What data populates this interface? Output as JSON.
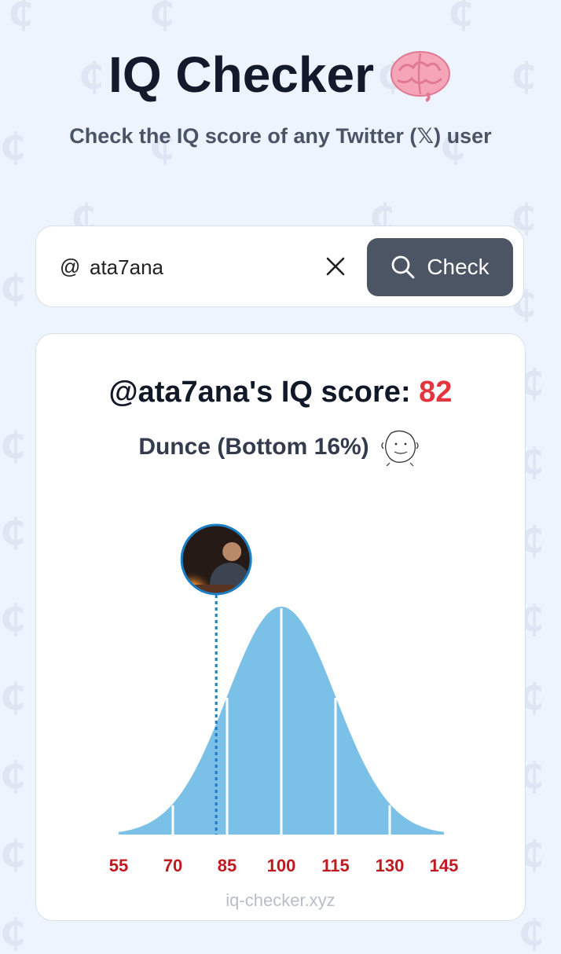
{
  "app": {
    "title": "IQ Checker",
    "title_emoji": "🧠",
    "subtitle": "Check the IQ score of any Twitter (𝕏) user"
  },
  "search": {
    "at_symbol": "@",
    "value": "ata7ana",
    "clear_icon": "close-icon",
    "button_icon": "search-icon",
    "button_label": "Check"
  },
  "result": {
    "score_prefix": "@ata7ana's IQ score: ",
    "score": "82",
    "rank_label": "Dunce (Bottom 16%)",
    "footer": "iq-checker.xyz"
  },
  "colors": {
    "accent_red": "#e5343d",
    "curve_fill": "#7bc0e6",
    "marker_blue": "#1b7fc6",
    "tick_red": "#c0191f",
    "button_bg": "#4b5563"
  },
  "chart_data": {
    "type": "area",
    "title": "",
    "xlabel": "",
    "ylabel": "",
    "distribution": "normal",
    "mean": 100,
    "sd": 15,
    "xlim": [
      55,
      145
    ],
    "x_ticks": [
      55,
      70,
      85,
      100,
      115,
      130,
      145
    ],
    "segment_boundaries": [
      70,
      85,
      100,
      115,
      130
    ],
    "marker": {
      "x": 82,
      "label": "user avatar"
    }
  }
}
